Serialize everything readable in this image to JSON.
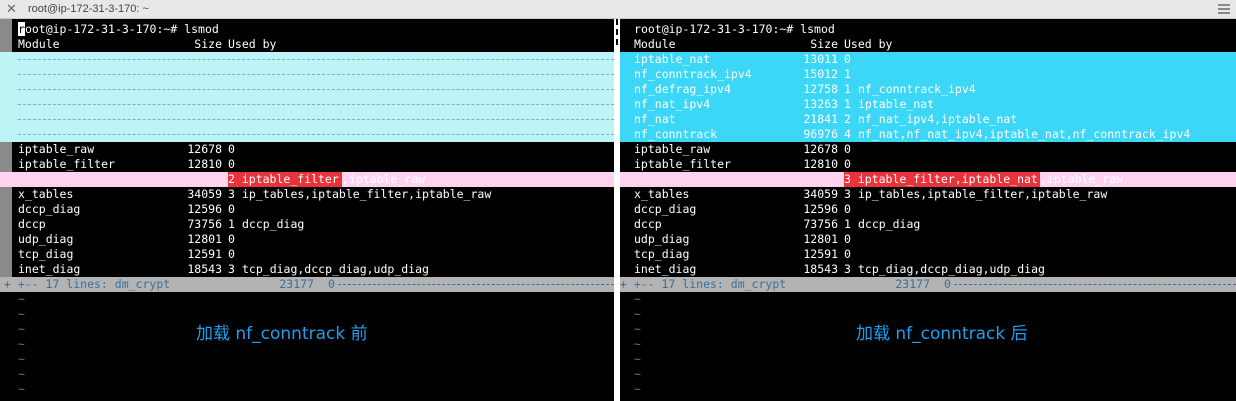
{
  "window": {
    "title": "root@ip-172-31-3-170: ~",
    "close_glyph": "✕"
  },
  "header": {
    "prompt_first": "r",
    "prompt_rest": "oot@ip-172-31-3-170:~# lsmod",
    "col_module": "Module",
    "col_size": "Size",
    "col_used": "Used by"
  },
  "left": {
    "rows_top": [
      {
        "module": "iptable_raw",
        "size": "12678",
        "count": "0",
        "used": ""
      },
      {
        "module": "iptable_filter",
        "size": "12810",
        "count": "0",
        "used": ""
      }
    ],
    "pink_row": {
      "module": "ip_tables",
      "size": "27239",
      "red": "2 iptable_filter",
      "rest": ",iptable_raw"
    },
    "rows_bottom": [
      {
        "module": "x_tables",
        "size": "34059",
        "count": "3",
        "used": "ip_tables,iptable_filter,iptable_raw"
      },
      {
        "module": "dccp_diag",
        "size": "12596",
        "count": "0",
        "used": ""
      },
      {
        "module": "dccp",
        "size": "73756",
        "count": "1",
        "used": "dccp_diag"
      },
      {
        "module": "udp_diag",
        "size": "12801",
        "count": "0",
        "used": ""
      },
      {
        "module": "tcp_diag",
        "size": "12591",
        "count": "0",
        "used": ""
      },
      {
        "module": "inet_diag",
        "size": "18543",
        "count": "3",
        "used": "tcp_diag,dccp_diag,udp_diag"
      }
    ],
    "fold": {
      "lead": "+ +-- 17 lines: dm_crypt",
      "size": "23177",
      "tail": "0"
    },
    "caption": "加载 nf_conntrack 前"
  },
  "right": {
    "rows_cyan": [
      {
        "module": "iptable_nat",
        "size": "13011",
        "count": "0",
        "used": ""
      },
      {
        "module": "nf_conntrack_ipv4",
        "size": "15012",
        "count": "1",
        "used": ""
      },
      {
        "module": "nf_defrag_ipv4",
        "size": "12758",
        "count": "1",
        "used": "nf_conntrack_ipv4"
      },
      {
        "module": "nf_nat_ipv4",
        "size": "13263",
        "count": "1",
        "used": "iptable_nat"
      },
      {
        "module": "nf_nat",
        "size": "21841",
        "count": "2",
        "used": "nf_nat_ipv4,iptable_nat"
      },
      {
        "module": "nf_conntrack",
        "size": "96976",
        "count": "4",
        "used": "nf_nat,nf_nat_ipv4,iptable_nat,nf_conntrack_ipv4"
      }
    ],
    "rows_top": [
      {
        "module": "iptable_raw",
        "size": "12678",
        "count": "0",
        "used": ""
      },
      {
        "module": "iptable_filter",
        "size": "12810",
        "count": "0",
        "used": ""
      }
    ],
    "pink_row": {
      "module": "ip_tables",
      "size": "27239",
      "red": "3 iptable_filter,iptable_nat",
      "rest": ",iptable_raw"
    },
    "rows_bottom": [
      {
        "module": "x_tables",
        "size": "34059",
        "count": "3",
        "used": "ip_tables,iptable_filter,iptable_raw"
      },
      {
        "module": "dccp_diag",
        "size": "12596",
        "count": "0",
        "used": ""
      },
      {
        "module": "dccp",
        "size": "73756",
        "count": "1",
        "used": "dccp_diag"
      },
      {
        "module": "udp_diag",
        "size": "12801",
        "count": "0",
        "used": ""
      },
      {
        "module": "tcp_diag",
        "size": "12591",
        "count": "0",
        "used": ""
      },
      {
        "module": "inet_diag",
        "size": "18543",
        "count": "3",
        "used": "tcp_diag,dccp_diag,udp_diag"
      }
    ],
    "fold": {
      "lead": "+ +-- 17 lines: dm_crypt",
      "size": "23177",
      "tail": "0"
    },
    "caption": "加载 nf_conntrack 后"
  },
  "tilde": "~",
  "colors": {
    "diff_added": "#3cd6f7",
    "diff_filler": "#bff4f7",
    "diff_changed": "#ffd2ef",
    "diff_text_change": "#e8323c",
    "fold_bg": "#b3b3b3",
    "caption": "#1f9ff0"
  }
}
